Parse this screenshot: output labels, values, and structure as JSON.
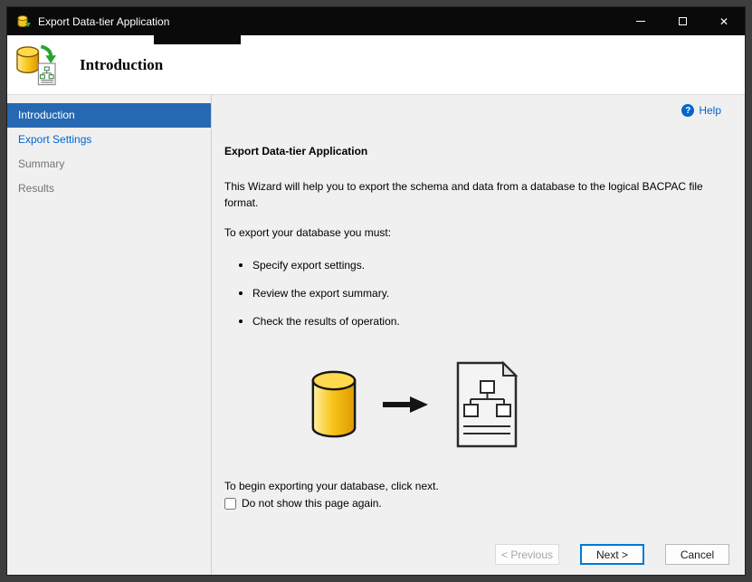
{
  "window": {
    "title": "Export Data-tier Application",
    "controls": {
      "close_glyph": "✕"
    }
  },
  "header": {
    "title": "Introduction"
  },
  "sidebar": {
    "items": [
      {
        "label": "Introduction",
        "state": "active"
      },
      {
        "label": "Export Settings",
        "state": "enabled"
      },
      {
        "label": "Summary",
        "state": "disabled"
      },
      {
        "label": "Results",
        "state": "disabled"
      }
    ]
  },
  "main": {
    "help_label": "Help",
    "help_glyph": "?",
    "heading": "Export Data-tier Application",
    "intro": "This Wizard will help you to export the schema and data from a database to the logical BACPAC file format.",
    "requirements_intro": "To export your database you must:",
    "bullets": [
      "Specify export settings.",
      "Review the export summary.",
      "Check the results of operation."
    ],
    "footer_note": "To begin exporting your database, click next.",
    "checkbox_label": "Do not show this page again.",
    "checkbox_checked": false
  },
  "actions": {
    "previous": "< Previous",
    "next": "Next >",
    "cancel": "Cancel"
  },
  "colors": {
    "link_blue": "#0066cc",
    "selected_item_bg": "#2668b2",
    "focus_border": "#0078d4",
    "database_yellow": "#f8c51c",
    "titlebar_bg": "#0a0a0a"
  }
}
